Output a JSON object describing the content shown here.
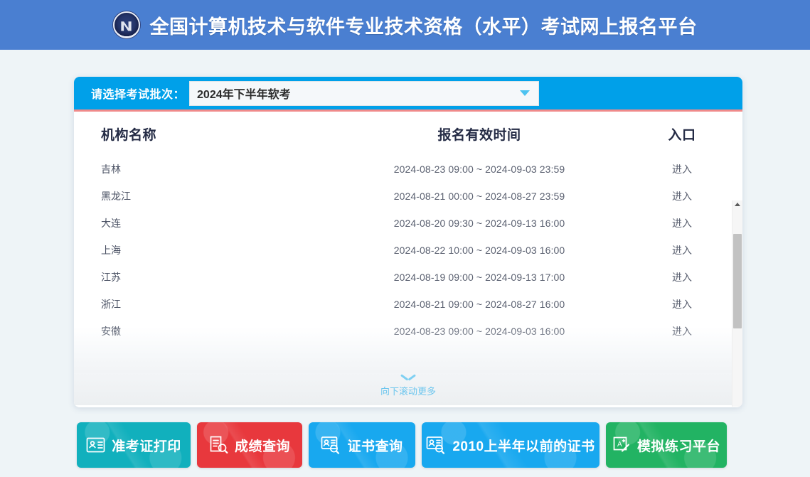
{
  "header": {
    "title": "全国计算机技术与软件专业技术资格（水平）考试网上报名平台",
    "logo_icon": "emblem-logo-icon",
    "background_color": "#4a7fd1"
  },
  "select_bar": {
    "label": "请选择考试批次：",
    "selected_value": "2024年下半年软考",
    "caret_icon": "chevron-down-icon",
    "background_color": "#00a0e9",
    "accent_underline_color": "#f08a8a"
  },
  "table": {
    "columns": [
      "机构名称",
      "报名有效时间",
      "入口"
    ],
    "rows": [
      {
        "org": "吉林",
        "time": "2024-08-23 09:00 ~ 2024-09-03 23:59",
        "entry": "进入"
      },
      {
        "org": "黑龙江",
        "time": "2024-08-21 00:00 ~ 2024-08-27 23:59",
        "entry": "进入"
      },
      {
        "org": "大连",
        "time": "2024-08-20 09:30 ~ 2024-09-13 16:00",
        "entry": "进入"
      },
      {
        "org": "上海",
        "time": "2024-08-22 10:00 ~ 2024-09-03 16:00",
        "entry": "进入"
      },
      {
        "org": "江苏",
        "time": "2024-08-19 09:00 ~ 2024-09-13 17:00",
        "entry": "进入"
      },
      {
        "org": "浙江",
        "time": "2024-08-21 09:00 ~ 2024-08-27 16:00",
        "entry": "进入"
      },
      {
        "org": "安徽",
        "time": "2024-08-23 09:00 ~ 2024-09-03 16:00",
        "entry": "进入"
      }
    ]
  },
  "scroll_more": {
    "text": "向下滚动更多",
    "icon": "chevron-down-icon",
    "color": "#6dc6ee"
  },
  "scrollbar": {
    "up_arrow_icon": "scroll-up-arrow-icon",
    "thumb_color": "#c2c2c2"
  },
  "buttons": [
    {
      "label": "准考证打印",
      "color": "#11b0bd",
      "icon": "id-card-icon"
    },
    {
      "label": "成绩查询",
      "color": "#e8383d",
      "icon": "document-search-icon"
    },
    {
      "label": "证书查询",
      "color": "#18a8ef",
      "icon": "certificate-search-icon"
    },
    {
      "label": "2010上半年以前的证书",
      "color": "#18a8ef",
      "icon": "certificate-search-icon"
    },
    {
      "label": "模拟练习平台",
      "color": "#22b363",
      "icon": "exam-practice-icon"
    }
  ]
}
